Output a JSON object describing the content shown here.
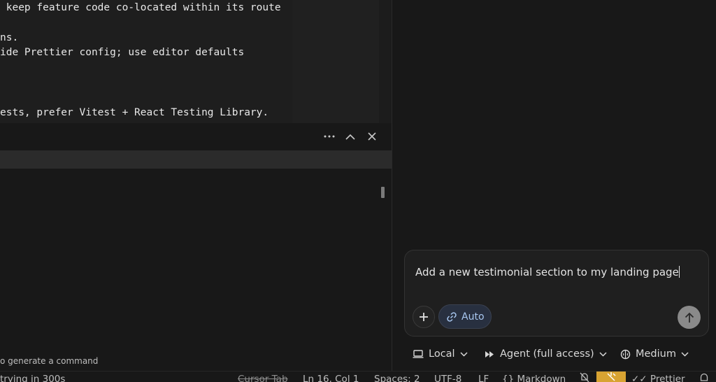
{
  "editor": {
    "lines": [
      " keep feature code co-located within its route",
      "ns.",
      "ide Prettier config; use editor defaults",
      "ests, prefer Vitest + React Testing Library."
    ]
  },
  "panel": {
    "hint": "o generate a command"
  },
  "chat": {
    "composer_text": "Add a new testimonial section to my landing page",
    "auto_label": "Auto",
    "local_label": "Local",
    "agent_label": "Agent (full access)",
    "medium_label": "Medium"
  },
  "statusbar": {
    "retry": "trying in 300s",
    "cursor_tab": "Cursor Tab",
    "position": "Ln 16, Col 1",
    "spaces": "Spaces: 2",
    "encoding": "UTF-8",
    "eol": "LF",
    "language": "Markdown",
    "prettier": "Prettier"
  }
}
